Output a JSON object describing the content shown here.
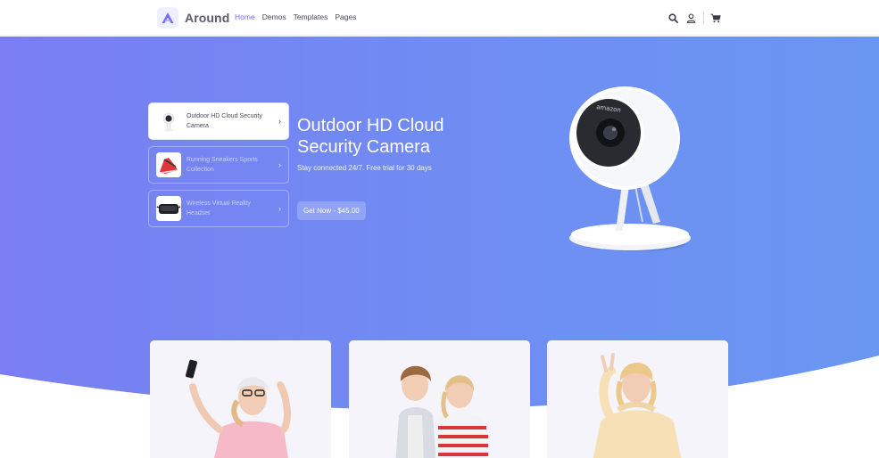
{
  "brand": {
    "name": "Around",
    "logo_icon": "around-logo-icon",
    "accent": "#766df4"
  },
  "nav": {
    "links": [
      {
        "label": "Home",
        "active": true
      },
      {
        "label": "Demos",
        "active": false
      },
      {
        "label": "Templates",
        "active": false
      },
      {
        "label": "Pages",
        "active": false
      }
    ],
    "tools": [
      "search-icon",
      "user-icon",
      "cart-icon"
    ]
  },
  "hero": {
    "tiles": [
      {
        "label": "Outdoor HD Cloud Security Camera",
        "active": true,
        "thumb_icon": "security-camera-thumb"
      },
      {
        "label": "Running Sneakers Sports Collection",
        "active": false,
        "thumb_icon": "sneaker-thumb"
      },
      {
        "label": "Wireless Virtual Reality Headset",
        "active": false,
        "thumb_icon": "vr-headset-thumb"
      }
    ],
    "title": "Outdoor HD Cloud Security Camera",
    "subtitle": "Stay connected 24/7. Free trial for 30 days",
    "cta_label": "Get Now - $45.00",
    "gradient": [
      "#7a7ef2",
      "#6a97f2"
    ]
  },
  "cards": [
    {
      "image": "woman-selfie-photo"
    },
    {
      "image": "kids-photo"
    },
    {
      "image": "girl-hoodie-photo"
    }
  ]
}
